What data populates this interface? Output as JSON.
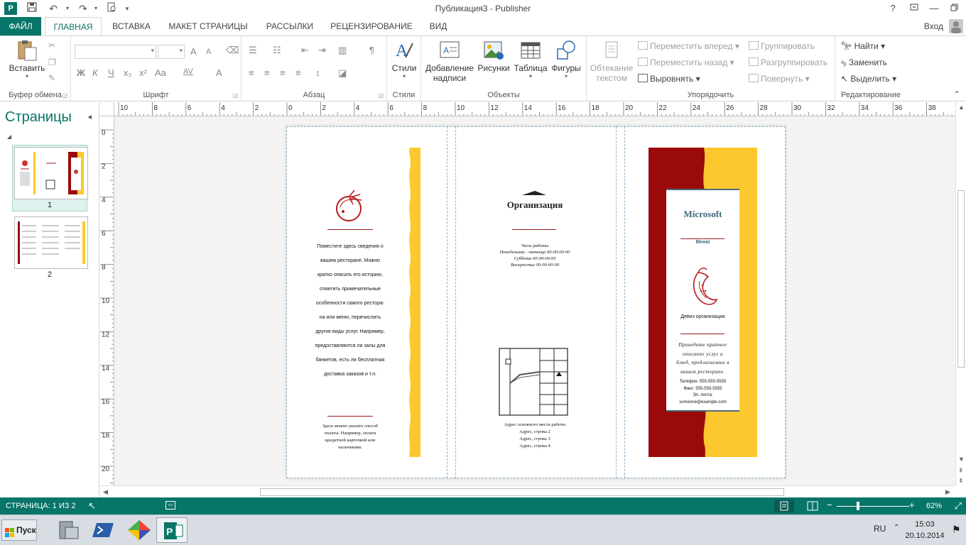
{
  "window": {
    "title": "Публикация3 - Publisher",
    "app_icon_letter": "P",
    "help": "?",
    "signin": "Вход"
  },
  "tabs": [
    "ФАЙЛ",
    "ГЛАВНАЯ",
    "ВСТАВКА",
    "МАКЕТ СТРАНИЦЫ",
    "РАССЫЛКИ",
    "РЕЦЕНЗИРОВАНИЕ",
    "ВИД"
  ],
  "ribbon": {
    "clipboard": {
      "paste": "Вставить",
      "label": "Буфер обмена"
    },
    "font": {
      "label": "Шрифт",
      "bold": "Ж",
      "italic": "К",
      "underline": "Ч",
      "sub": "x₂",
      "sup": "x²",
      "case": "Aa",
      "spacing": "AV",
      "color": "A",
      "grow": "A",
      "shrink": "A"
    },
    "paragraph": {
      "label": "Абзац",
      "pilcrow": "¶"
    },
    "styles": {
      "button": "Стили",
      "label": "Стили"
    },
    "objects": {
      "label": "Объекты",
      "textbox_line1": "Добавление",
      "textbox_line2": "надписи",
      "pictures": "Рисунки",
      "table": "Таблица",
      "shapes": "Фигуры"
    },
    "arrange": {
      "label": "Упорядочить",
      "wrap_line1": "Обтекание",
      "wrap_line2": "текстом",
      "bring_forward": "Переместить вперед",
      "send_backward": "Переместить назад",
      "align": "Выровнять",
      "group": "Группировать",
      "ungroup": "Разгруппировать",
      "rotate": "Повернуть"
    },
    "editing": {
      "label": "Редактирование",
      "find": "Найти",
      "replace": "Заменить",
      "select": "Выделить"
    }
  },
  "pages_pane": {
    "title": "Страницы",
    "pages": [
      "1",
      "2"
    ]
  },
  "ruler": {
    "h_labels": [
      "10",
      "8",
      "6",
      "4",
      "2",
      "0",
      "2",
      "4",
      "6",
      "8",
      "10",
      "12",
      "14",
      "16",
      "18",
      "20",
      "22",
      "24",
      "26",
      "28",
      "30",
      "32",
      "34",
      "36",
      "38"
    ],
    "v_labels": [
      "0",
      "2",
      "4",
      "6",
      "8",
      "10",
      "12",
      "14",
      "16",
      "18",
      "20"
    ]
  },
  "publication": {
    "panel1_text": [
      "Поместите здесь сведения о",
      "вашем ресторане. Можно",
      "кратко описать его историю,",
      "отметить примечательные",
      "особенности самого рестора-",
      "на или меню, перечислить",
      "другие виды услуг. Например,",
      "предоставляются ли залы для",
      "банкетов, есть ли бесплатная",
      "доставка заказов и т.п."
    ],
    "panel1_payment": [
      "Здесь можно указать способ",
      "оплаты. Например, оплата",
      "кредитной карточкой или",
      "наличными."
    ],
    "panel2_org": "Организация",
    "panel2_hours": [
      "Часы работы",
      "Понедельник - пятница 00:00-00:00",
      "Суббота 00:00-00:00",
      "Воскресенье 00:00-00:00"
    ],
    "panel2_address": [
      "Адрес основного места работы",
      "Адрес, строка 2",
      "Адрес, строка 3",
      "Адрес, строка 4"
    ],
    "panel3_brand": "Microsoft",
    "panel3_menu": "Меню",
    "panel3_motto": "Девиз организации",
    "panel3_desc": [
      "Приведите краткое",
      "описание услуг и",
      "блюд, предлагаемых в",
      "вашем ресторане."
    ],
    "panel3_contacts": [
      "Телефон: 555-555-5555",
      "Факс: 555-555-5555",
      "Эл. почта:",
      "someone@example.com"
    ]
  },
  "status": {
    "page": "СТРАНИЦА: 1 ИЗ 2",
    "zoom": "62%"
  },
  "taskbar": {
    "start": "Пуск",
    "lang": "RU",
    "time": "15:03",
    "date": "20.10.2014"
  },
  "colors": {
    "accent": "#077568",
    "brochure_red": "#9b0a0a",
    "brochure_yellow": "#fdc82f"
  }
}
